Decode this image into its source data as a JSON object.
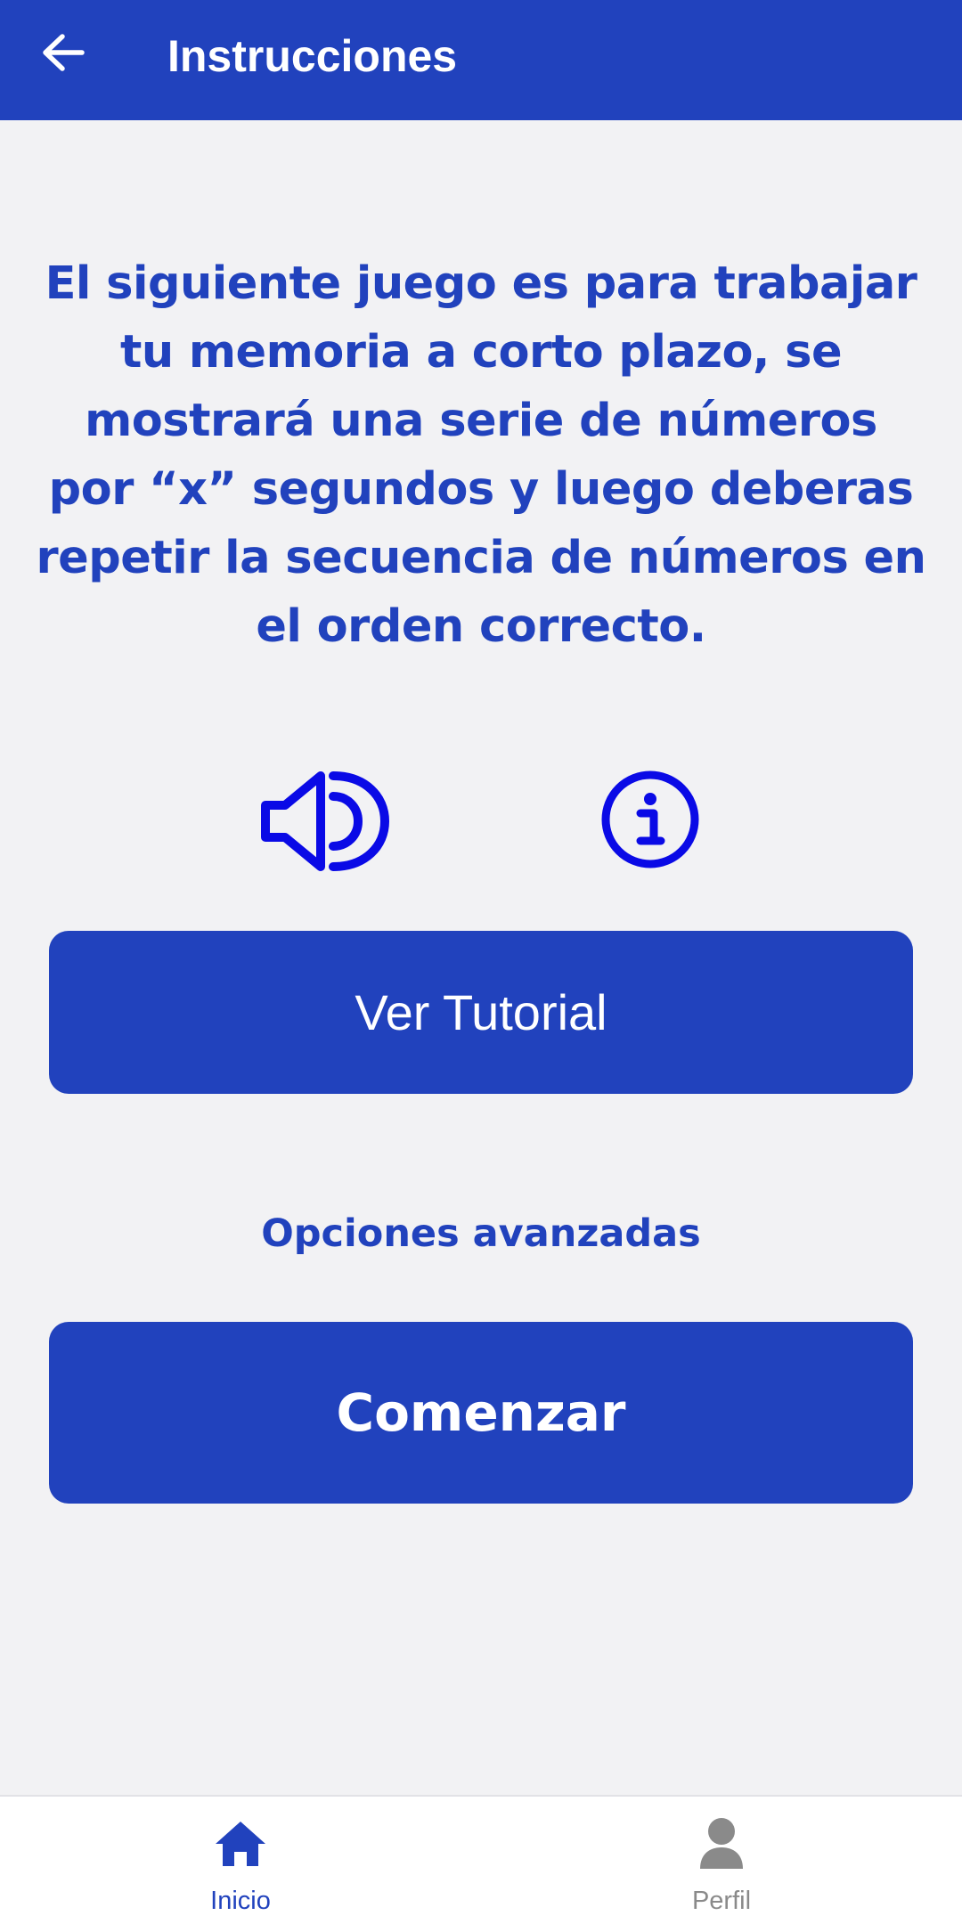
{
  "header": {
    "title": "Instrucciones",
    "back_icon": "arrow-left-icon",
    "background": "#2142bd"
  },
  "main": {
    "instructions": "El siguiente juego es para trabajar tu memoria a corto plazo, se mostrará una serie de números por “x” segundos y luego deberas repetir la secuencia de números en el orden correcto.",
    "speaker_icon": "speaker-icon",
    "info_icon": "info-icon",
    "tutorial_button": "Ver Tutorial",
    "advanced_options": "Opciones avanzadas",
    "start_button": "Comenzar"
  },
  "bottom_nav": {
    "items": [
      {
        "label": "Inicio",
        "icon": "home-icon",
        "active": true
      },
      {
        "label": "Perfil",
        "icon": "user-icon",
        "active": false
      }
    ]
  },
  "colors": {
    "primary": "#2142bd",
    "icon_blue": "#0a0ae6",
    "background": "#f2f2f4",
    "inactive": "#8a8a8a"
  }
}
